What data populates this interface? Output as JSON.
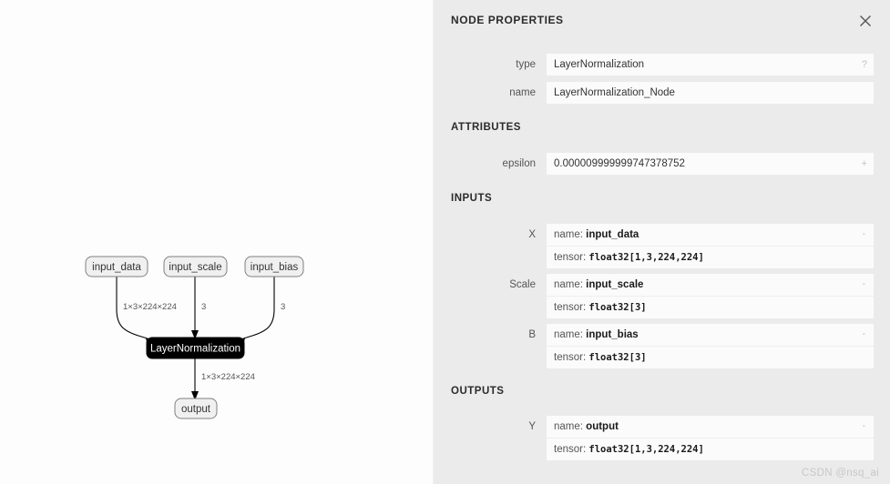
{
  "panel": {
    "title": "NODE PROPERTIES",
    "close_icon": "close-icon",
    "fields": [
      {
        "label": "type",
        "value": "LayerNormalization",
        "hint": "?"
      },
      {
        "label": "name",
        "value": "LayerNormalization_Node",
        "hint": ""
      }
    ],
    "attributes_title": "ATTRIBUTES",
    "attributes": [
      {
        "label": "epsilon",
        "value": "0.000009999999747378752",
        "hint": "+"
      }
    ],
    "inputs_title": "INPUTS",
    "inputs": [
      {
        "label": "X",
        "name_key": "name:",
        "name_value": "input_data",
        "tensor_key": "tensor:",
        "tensor_value": "float32[1,3,224,224]",
        "collapse": "-"
      },
      {
        "label": "Scale",
        "name_key": "name:",
        "name_value": "input_scale",
        "tensor_key": "tensor:",
        "tensor_value": "float32[3]",
        "collapse": "-"
      },
      {
        "label": "B",
        "name_key": "name:",
        "name_value": "input_bias",
        "tensor_key": "tensor:",
        "tensor_value": "float32[3]",
        "collapse": "-"
      }
    ],
    "outputs_title": "OUTPUTS",
    "outputs": [
      {
        "label": "Y",
        "name_key": "name:",
        "name_value": "output",
        "tensor_key": "tensor:",
        "tensor_value": "float32[1,3,224,224]",
        "collapse": "-"
      }
    ]
  },
  "graph": {
    "nodes": [
      {
        "id": "input_data",
        "label": "input_data",
        "kind": "io"
      },
      {
        "id": "input_scale",
        "label": "input_scale",
        "kind": "io"
      },
      {
        "id": "input_bias",
        "label": "input_bias",
        "kind": "io"
      },
      {
        "id": "op",
        "label": "LayerNormalization",
        "kind": "op"
      },
      {
        "id": "output",
        "label": "output",
        "kind": "io"
      }
    ],
    "edge_labels": {
      "data_to_op": "1×3×224×224",
      "scale_to_op": "3",
      "bias_to_op": "3",
      "op_to_output": "1×3×224×224"
    }
  },
  "watermark": "CSDN @nsq_ai",
  "colors": {
    "panel_bg": "#ebebeb",
    "card_bg": "#fbfbfb",
    "op_node_bg": "#000000",
    "io_node_bg": "#f0f0f0",
    "canvas_bg": "#fdfdfd"
  }
}
